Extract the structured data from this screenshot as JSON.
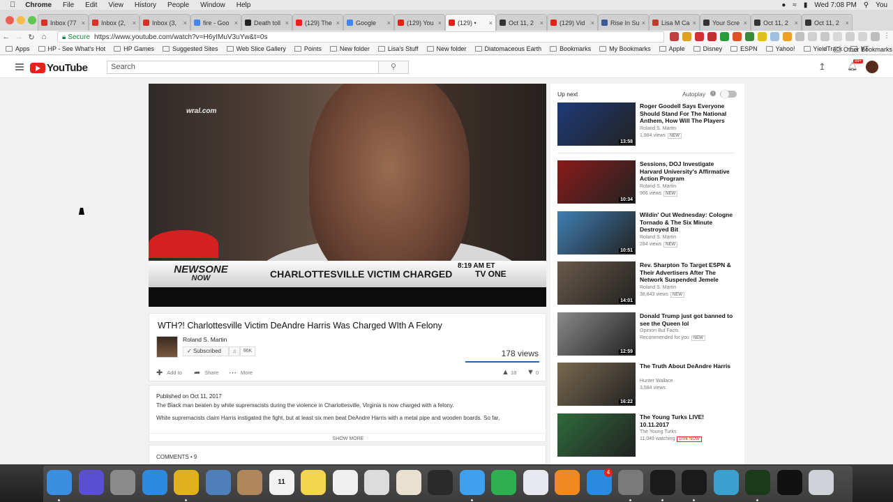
{
  "macmenu": {
    "app": "Chrome",
    "items": [
      "File",
      "Edit",
      "View",
      "History",
      "People",
      "Window",
      "Help"
    ],
    "clock": "Wed 7:08 PM",
    "user": "You"
  },
  "tabs": [
    {
      "label": "Inbox (77",
      "color": "#d93025"
    },
    {
      "label": "Inbox (2,",
      "color": "#d93025"
    },
    {
      "label": "Inbox (3,",
      "color": "#d93025"
    },
    {
      "label": "fire - Goo",
      "color": "#4285f4"
    },
    {
      "label": "Death toll",
      "color": "#222222"
    },
    {
      "label": "(129) The",
      "color": "#e62117"
    },
    {
      "label": "Google",
      "color": "#4285f4"
    },
    {
      "label": "(129) You",
      "color": "#e62117"
    },
    {
      "label": "(129) •",
      "color": "#e62117",
      "active": true
    },
    {
      "label": "Oct 11, 2",
      "color": "#333333"
    },
    {
      "label": "(129) Vid",
      "color": "#e62117"
    },
    {
      "label": "Rise In Su",
      "color": "#3b5998"
    },
    {
      "label": "Lisa M Ca",
      "color": "#c0392b"
    },
    {
      "label": "Your Scre",
      "color": "#333333"
    },
    {
      "label": "Oct 11, 2",
      "color": "#333333"
    },
    {
      "label": "Oct 11, 2",
      "color": "#333333"
    }
  ],
  "address": {
    "secure": "Secure",
    "url": "https://www.youtube.com/watch?v=H6yIMuV3uYw&t=0s"
  },
  "bookmarks": [
    "Apps",
    "HP - See What's Hot",
    "HP Games",
    "Suggested Sites",
    "Web Slice Gallery",
    "Points",
    "New folder",
    "Lisa's Stuff",
    "New folder",
    "Diatomaceous Earth",
    "Bookmarks",
    "My Bookmarks",
    "Apple",
    "Disney",
    "ESPN",
    "Yahoo!",
    "YieldTrack",
    "YT"
  ],
  "other_bookmarks": "Other Bookmarks",
  "youtube": {
    "logo": "YouTube",
    "search_placeholder": "Search",
    "bell_badge": "99+",
    "video": {
      "watermark": "wral.com",
      "brand_top": "NEWSONE",
      "brand_bottom": "NOW",
      "lower_third": "CHARLOTTESVILLE VICTIM CHARGED",
      "time": "8:19 AM ET",
      "network": "TV ONE"
    },
    "title": "WTH?! Charlottesville Victim DeAndre Harris Was Charged WIth A Felony",
    "channel": "Roland S. Martin",
    "subscribed": "Subscribed",
    "sub_count": "96K",
    "views": "178 views",
    "actions": {
      "add": "Add to",
      "share": "Share",
      "more": "More"
    },
    "likes": "18",
    "dislikes": "0",
    "published": "Published on Oct 11, 2017",
    "desc1": "The Black man beaten by white supremacists during the violence in Charlottesville, Virginia is now charged with a felony.",
    "desc2": "White supremacists claim Harris instigated the fight, but at least six men beat DeAndre Harris with a metal pipe and wooden boards. So far,",
    "show_more": "SHOW MORE",
    "comments": "COMMENTS • 9",
    "up_next": "Up next",
    "autoplay": "Autoplay",
    "sidebar": [
      {
        "title": "Roger Goodell Says Everyone Should Stand For The National Anthem, How Will The Players",
        "channel": "Roland S. Martin",
        "meta": "1,984 views",
        "badge": "NEW",
        "duration": "13:58",
        "thumb": "#1e3a78"
      },
      {
        "title": "Sessions, DOJ Investigate Harvard University's Affirmative Action Program",
        "channel": "Roland S. Martin",
        "meta": "966 views",
        "badge": "NEW",
        "duration": "10:34",
        "thumb": "#8b1a1a"
      },
      {
        "title": "Wildin' Out Wednesday: Cologne Tornado & The Six Minute Destroyed Bit",
        "channel": "Roland S. Martin",
        "meta": "284 views",
        "badge": "NEW",
        "duration": "10:51",
        "thumb": "#3f7fb5"
      },
      {
        "title": "Rev. Sharpton To Target ESPN & Their Advertisers After The Network Suspended Jemele",
        "channel": "Roland S. Martin",
        "meta": "38,843 views",
        "badge": "NEW",
        "duration": "14:01",
        "thumb": "#6a5a4a"
      },
      {
        "title": "Donald Trump just got banned to see the Queen lol",
        "channel": "Opinion But Facts",
        "meta": "Recommended for you",
        "badge": "NEW",
        "duration": "12:59",
        "thumb": "#8a8a8a"
      },
      {
        "title": "The Truth About DeAndre Harris",
        "channel": "Hunter Wallace",
        "meta": "3,584 views",
        "badge": "",
        "duration": "16:22",
        "thumb": "#7a6a50"
      },
      {
        "title": "The Young Turks LIVE! 10.11.2017",
        "channel": "The Young Turks",
        "meta": "11,049 watching",
        "badge": "LIVE NOW",
        "duration": "",
        "thumb": "#2e6b3a"
      }
    ]
  },
  "dock": [
    {
      "name": "finder",
      "color": "#3b8fe0"
    },
    {
      "name": "siri",
      "color": "#5b4fd1"
    },
    {
      "name": "launchpad",
      "color": "#8a8a8a"
    },
    {
      "name": "safari",
      "color": "#2b8be0"
    },
    {
      "name": "chrome",
      "color": "#e0b020"
    },
    {
      "name": "mail",
      "color": "#4f7fb8"
    },
    {
      "name": "contacts",
      "color": "#b0875a"
    },
    {
      "name": "calendar",
      "color": "#f2f2f2",
      "text": "11"
    },
    {
      "name": "notes",
      "color": "#f4d64e"
    },
    {
      "name": "reminders",
      "color": "#f0f0f0"
    },
    {
      "name": "preview",
      "color": "#dcdcdc"
    },
    {
      "name": "photos",
      "color": "#e9e0d0"
    },
    {
      "name": "photo-booth",
      "color": "#2a2a2a"
    },
    {
      "name": "messages",
      "color": "#3fa0f0"
    },
    {
      "name": "facetime",
      "color": "#2fb050"
    },
    {
      "name": "itunes",
      "color": "#e8e8f0"
    },
    {
      "name": "ibooks",
      "color": "#f08a20"
    },
    {
      "name": "app-store",
      "color": "#2a8ae0"
    },
    {
      "name": "system-preferences",
      "color": "#7a7a7a"
    },
    {
      "name": "terminal-1",
      "color": "#1a1a1a"
    },
    {
      "name": "terminal-2",
      "color": "#1a1a1a"
    },
    {
      "name": "network-app",
      "color": "#3aa0d0"
    },
    {
      "name": "clock-app",
      "color": "#1a3a1a"
    },
    {
      "name": "terminal",
      "color": "#111111"
    },
    {
      "name": "trash",
      "color": "#cfd3d8"
    }
  ],
  "dock_badge": "4"
}
